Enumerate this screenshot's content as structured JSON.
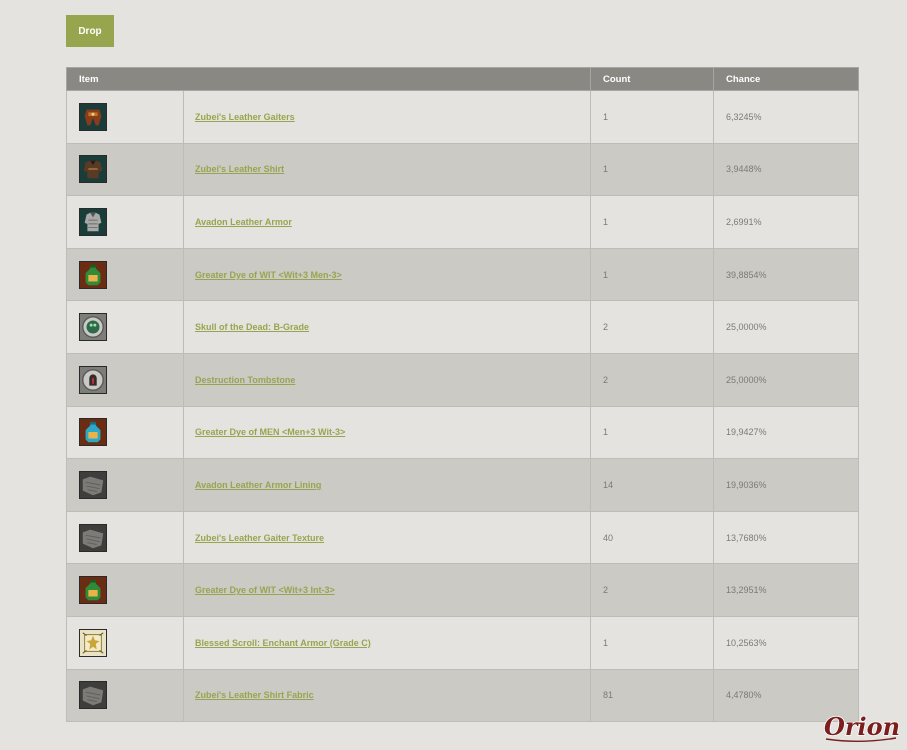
{
  "tab": {
    "label": "Drop"
  },
  "table": {
    "headers": {
      "item": "Item",
      "count": "Count",
      "chance": "Chance"
    },
    "rows": [
      {
        "icon": "leather-gaiters-icon",
        "name": "Zubei's Leather Gaiters",
        "count": "1",
        "chance": "6,3245%"
      },
      {
        "icon": "leather-shirt-icon",
        "name": "Zubei's Leather Shirt",
        "count": "1",
        "chance": "3,9448%"
      },
      {
        "icon": "leather-armor-icon",
        "name": "Avadon Leather Armor",
        "count": "1",
        "chance": "2,6991%"
      },
      {
        "icon": "dye-green-icon",
        "name": "Greater Dye of WIT <Wit+3 Men-3>",
        "count": "1",
        "chance": "39,8854%"
      },
      {
        "icon": "skull-orb-icon",
        "name": "Skull of the Dead: B-Grade",
        "count": "2",
        "chance": "25,0000%"
      },
      {
        "icon": "tombstone-orb-icon",
        "name": "Destruction Tombstone",
        "count": "2",
        "chance": "25,0000%"
      },
      {
        "icon": "dye-blue-icon",
        "name": "Greater Dye of MEN <Men+3 Wit-3>",
        "count": "1",
        "chance": "19,9427%"
      },
      {
        "icon": "fabric-icon",
        "name": "Avadon Leather Armor Lining",
        "count": "14",
        "chance": "19,9036%"
      },
      {
        "icon": "fabric-icon",
        "name": "Zubei's Leather Gaiter Texture",
        "count": "40",
        "chance": "13,7680%"
      },
      {
        "icon": "dye-green-icon",
        "name": "Greater Dye of WIT <Wit+3 Int-3>",
        "count": "2",
        "chance": "13,2951%"
      },
      {
        "icon": "scroll-icon",
        "name": "Blessed Scroll: Enchant Armor (Grade C)",
        "count": "1",
        "chance": "10,2563%"
      },
      {
        "icon": "fabric-icon",
        "name": "Zubei's Leather Shirt Fabric",
        "count": "81",
        "chance": "4,4780%"
      }
    ]
  },
  "logo": {
    "text": "Orion",
    "icon": "orion-logo"
  }
}
